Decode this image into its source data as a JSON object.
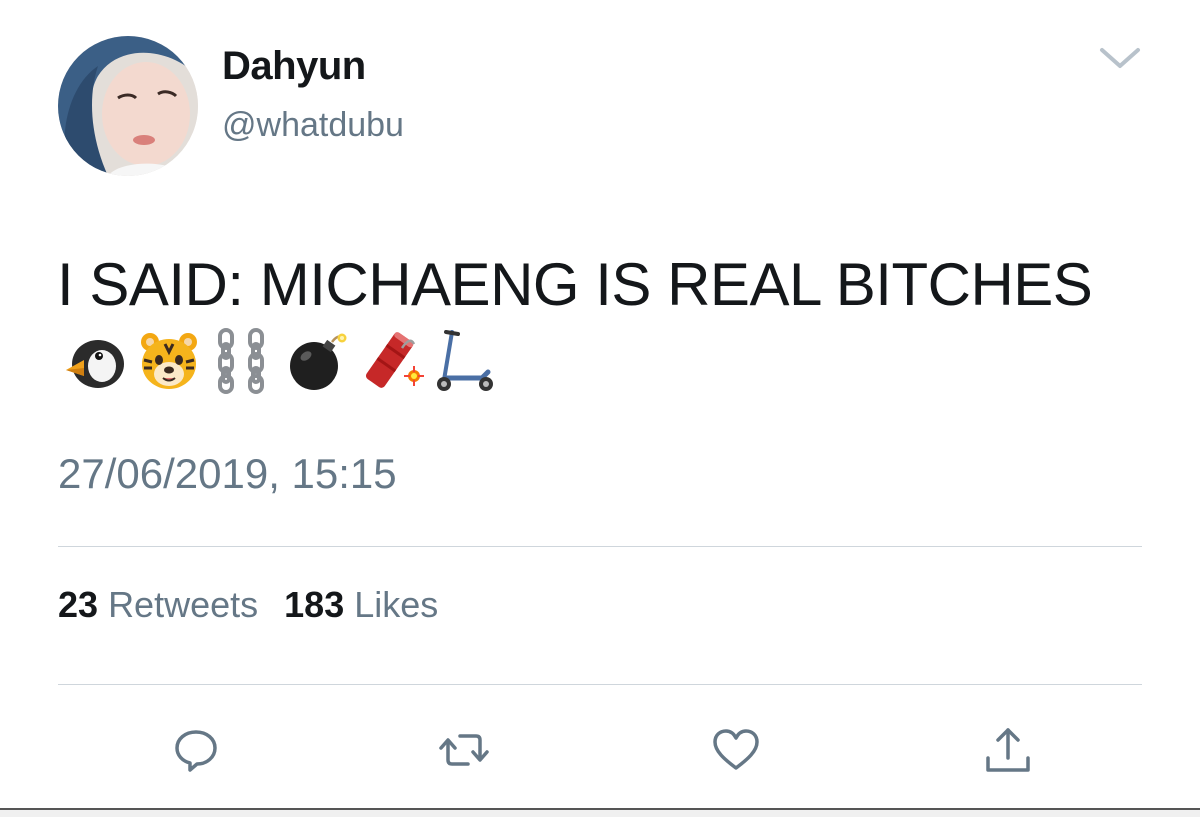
{
  "tweet": {
    "author": {
      "display_name": "Dahyun",
      "handle": "@whatdubu",
      "avatar_icon": "avatar-photo"
    },
    "text": "I SAID: MICHAENG IS REAL BITCHES",
    "emojis": [
      "penguin",
      "tiger-face",
      "chains",
      "bomb",
      "firecracker",
      "kick-scooter"
    ],
    "timestamp": "27/06/2019, 15:15",
    "stats": {
      "retweets_count": "23",
      "retweets_label": "Retweets",
      "likes_count": "183",
      "likes_label": "Likes"
    },
    "menu_icon": "chevron-down-icon",
    "actions": [
      "reply-icon",
      "retweet-icon",
      "like-icon",
      "share-icon"
    ]
  },
  "colors": {
    "primary_text": "#14171a",
    "secondary_text": "#657786",
    "icon": "#657786",
    "divider": "#cfd6dc"
  }
}
